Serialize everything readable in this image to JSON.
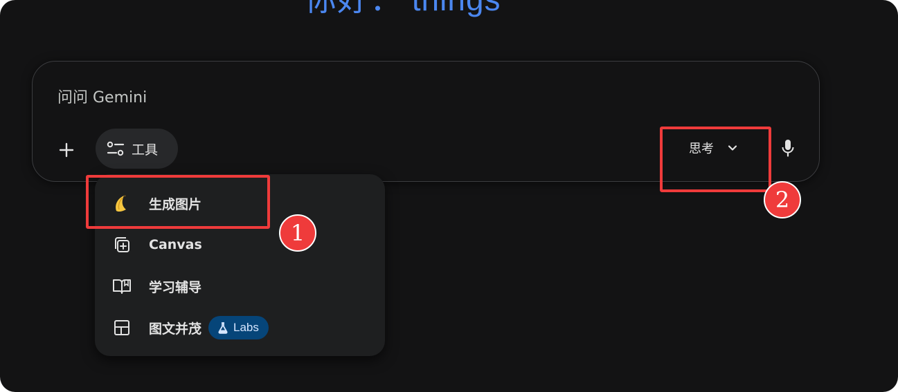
{
  "greeting": "你好： things",
  "composer": {
    "placeholder": "问问 Gemini",
    "tools_label": "工具",
    "mode_label": "思考"
  },
  "tools_menu": {
    "items": [
      {
        "icon": "banana-icon",
        "label": "生成图片"
      },
      {
        "icon": "canvas-icon",
        "label": "Canvas"
      },
      {
        "icon": "open-book-icon",
        "label": "学习辅导"
      },
      {
        "icon": "layout-icon",
        "label": "图文并茂",
        "badge": "Labs"
      }
    ]
  },
  "annotations": [
    "1",
    "2"
  ],
  "colors": {
    "background": "#131314",
    "greeting": "#4b87f0",
    "highlight": "#ef3b3b",
    "labs_badge": "#064579"
  }
}
